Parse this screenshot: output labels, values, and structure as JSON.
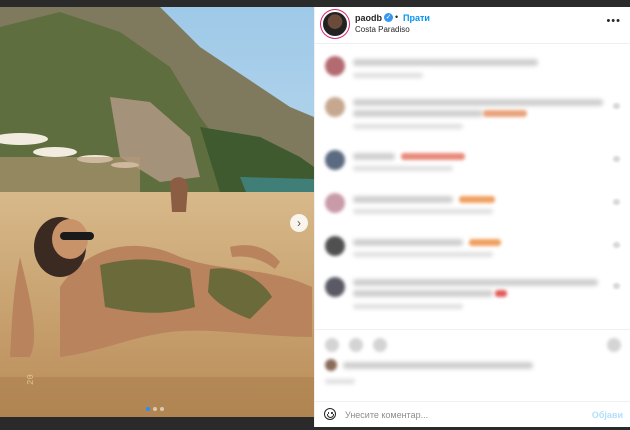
{
  "post": {
    "username": "paodb",
    "follow_label": "Прати",
    "separator": "•",
    "location": "Costa Paradiso",
    "more_icon": "more-horizontal-icon"
  },
  "media": {
    "next_icon": "›",
    "carousel_count": 3,
    "carousel_active": 1
  },
  "comments_blurred": true,
  "comment_bar": {
    "placeholder": "Унесите коментар...",
    "post_label": "Објави"
  },
  "colors": {
    "accent": "#0095f6",
    "post_disabled": "#b2dffc",
    "verified": "#3897f0"
  }
}
